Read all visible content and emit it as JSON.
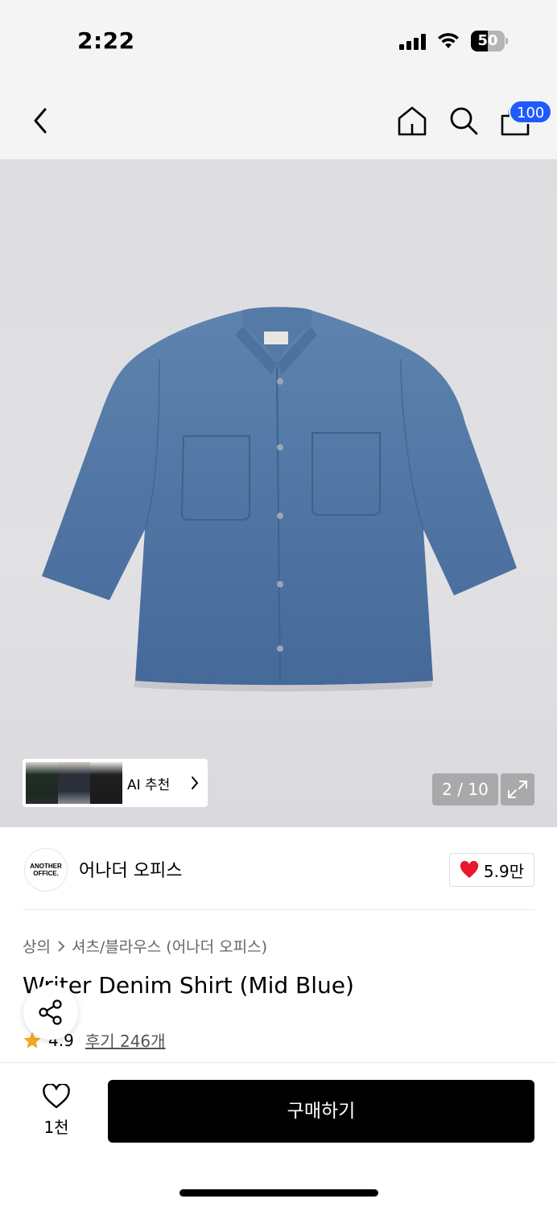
{
  "status_bar": {
    "time": "2:22",
    "battery": "50",
    "battery_level": 0.5
  },
  "nav": {
    "cart_count": "100"
  },
  "gallery": {
    "ai_recommend_label": "AI 추천",
    "pager": "2 / 10"
  },
  "brand": {
    "logo_text": "ANOTHER OFFICE.",
    "name": "어나더 오피스",
    "like_count": "5.9만"
  },
  "breadcrumb": {
    "category": "상의",
    "subcategory": "셔츠/블라우스 (어나더 오피스)"
  },
  "product": {
    "title": "Writer Denim Shirt (Mid Blue)",
    "rating": "4.9",
    "reviews": "후기 246개"
  },
  "bottom_bar": {
    "wish_count": "1천",
    "buy_label": "구매하기"
  },
  "colors": {
    "accent_blue": "#1e5bff",
    "heart_red": "#e8182a",
    "star": "#f5a623",
    "denim": "#4f76a3"
  }
}
